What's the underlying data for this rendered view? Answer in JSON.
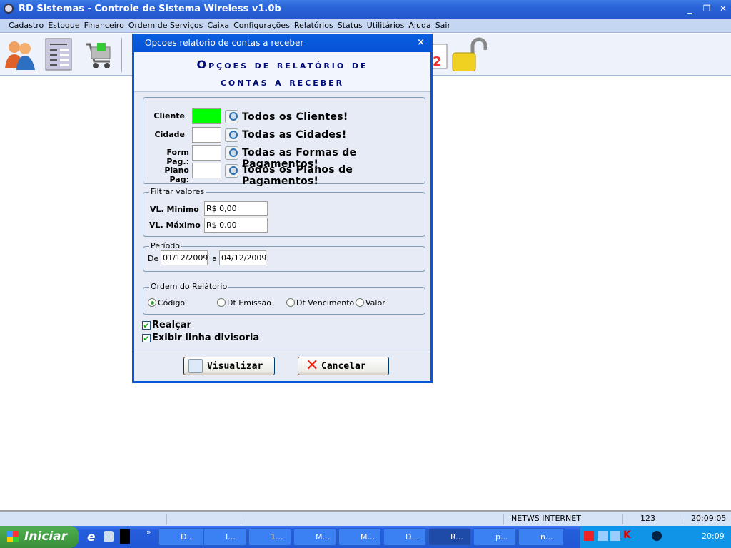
{
  "window": {
    "title": "RD Sistemas - Controle de Sistema Wireless v1.0b",
    "minimize": "_",
    "restore": "❐",
    "close": "✕"
  },
  "menu": [
    "Cadastro",
    "Estoque",
    "Financeiro",
    "Ordem de Serviços",
    "Caixa",
    "Configurações",
    "Relatórios",
    "Status",
    "Utilitários",
    "Ajuda",
    "Sair"
  ],
  "toolbar": {
    "icons": [
      "users-icon",
      "report-list-icon",
      "shopping-cart-icon",
      "calendar-icon",
      "padlock-icon"
    ]
  },
  "dialog": {
    "title": "Opcoes relatorio de contas a receber",
    "close": "×",
    "heading1": "Opçoes de relatório de",
    "heading2": "contas a receber",
    "filters": [
      {
        "label": "Cliente",
        "value": "",
        "text": "Todos os Clientes!"
      },
      {
        "label": "Cidade",
        "value": "",
        "text": "Todas as Cidades!"
      },
      {
        "label": "Form Pag.:",
        "value": "",
        "text": "Todas as Formas de Pagamentos!"
      },
      {
        "label": "Plano Pag:",
        "value": "",
        "text": "Todos os Planos de Pagamentos!"
      }
    ],
    "accent_cliente": "#00ff00",
    "valores": {
      "legend": "Filtrar valores",
      "min_label": "VL. Minimo",
      "min_value": "R$ 0,00",
      "max_label": "VL. Máximo",
      "max_value": "R$ 0,00"
    },
    "periodo": {
      "legend": "Período",
      "de": "De",
      "from": "01/12/2009",
      "a": "a",
      "to": "04/12/2009"
    },
    "ordem": {
      "legend": "Ordem do Relátorio",
      "options": [
        "Código",
        "Dt Emissão",
        "Dt Vencimento",
        "Valor"
      ],
      "selected": "Código"
    },
    "realcar": {
      "label": "Realçar",
      "checked": true
    },
    "linha": {
      "label": "Exibir linha divisoria",
      "checked": true
    },
    "visualizar": {
      "key": "V",
      "rest": "isualizar"
    },
    "cancelar": {
      "key": "C",
      "rest": "ancelar"
    }
  },
  "status": {
    "company": "NETWS INTERNET",
    "user": "123",
    "time": "20:09:05"
  },
  "taskbar": {
    "start": "Iniciar",
    "more": "»",
    "tasks": [
      "D...",
      "I...",
      "1...",
      "M...",
      "M...",
      "D...",
      "R...",
      "p...",
      "n..."
    ],
    "clock": "20:09"
  }
}
